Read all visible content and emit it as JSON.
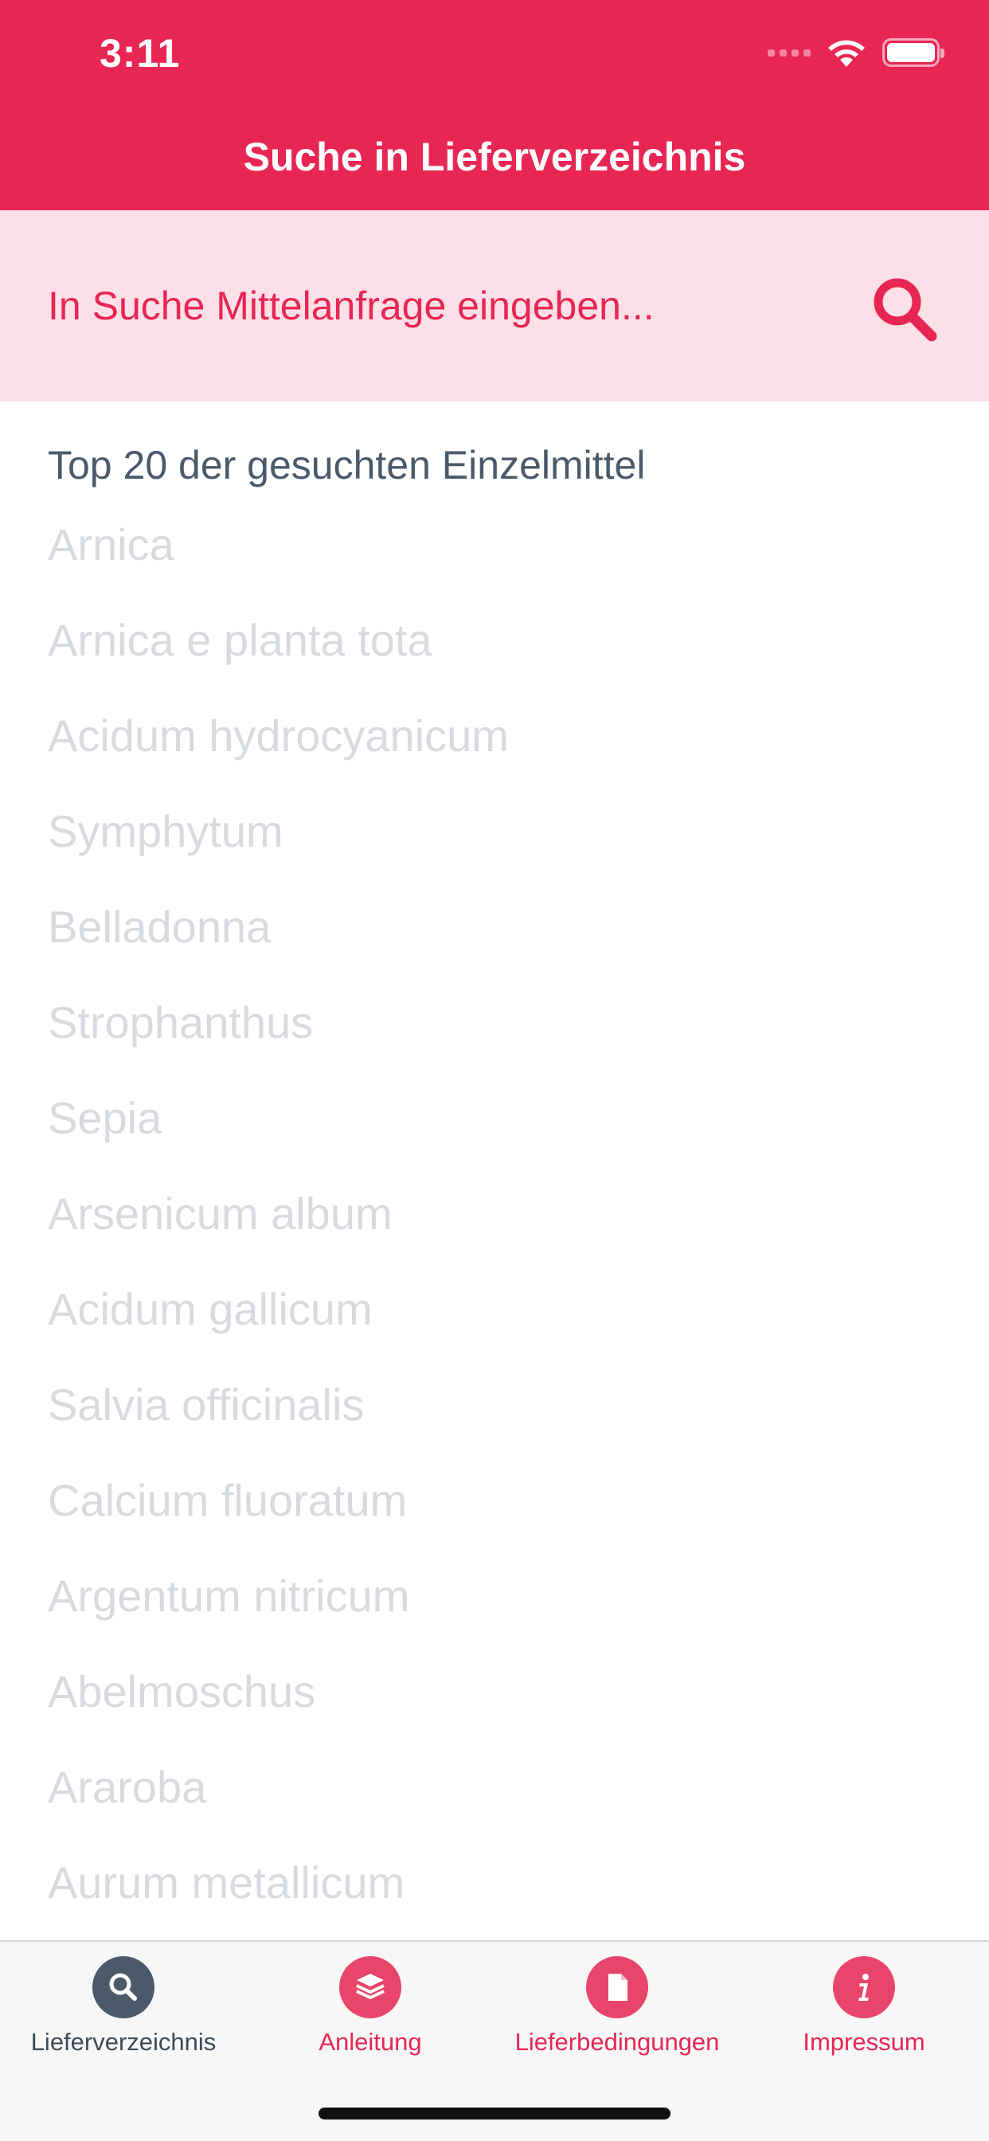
{
  "status_bar": {
    "time": "3:11"
  },
  "nav": {
    "title": "Suche in Lieferverzeichnis"
  },
  "search": {
    "placeholder": "In Suche Mittelanfrage eingeben..."
  },
  "section": {
    "title": "Top 20 der gesuchten Einzelmittel"
  },
  "drugs": [
    "Arnica",
    "Arnica e planta tota",
    "Acidum hydrocyanicum",
    "Symphytum",
    "Belladonna",
    "Strophanthus",
    "Sepia",
    "Arsenicum album",
    "Acidum gallicum",
    "Salvia officinalis",
    "Calcium fluoratum",
    "Argentum nitricum",
    "Abelmoschus",
    "Araroba",
    "Aurum metallicum"
  ],
  "tabs": [
    {
      "label": "Lieferverzeichnis",
      "icon": "search-icon",
      "active": true
    },
    {
      "label": "Anleitung",
      "icon": "layers-icon",
      "active": false
    },
    {
      "label": "Lieferbedingungen",
      "icon": "document-icon",
      "active": false
    },
    {
      "label": "Impressum",
      "icon": "info-icon",
      "active": false
    }
  ],
  "colors": {
    "brand": "#e82654",
    "search_bg": "#fde0e7",
    "active_tab": "#4a5a6a",
    "list_text": "#d7dadf"
  }
}
